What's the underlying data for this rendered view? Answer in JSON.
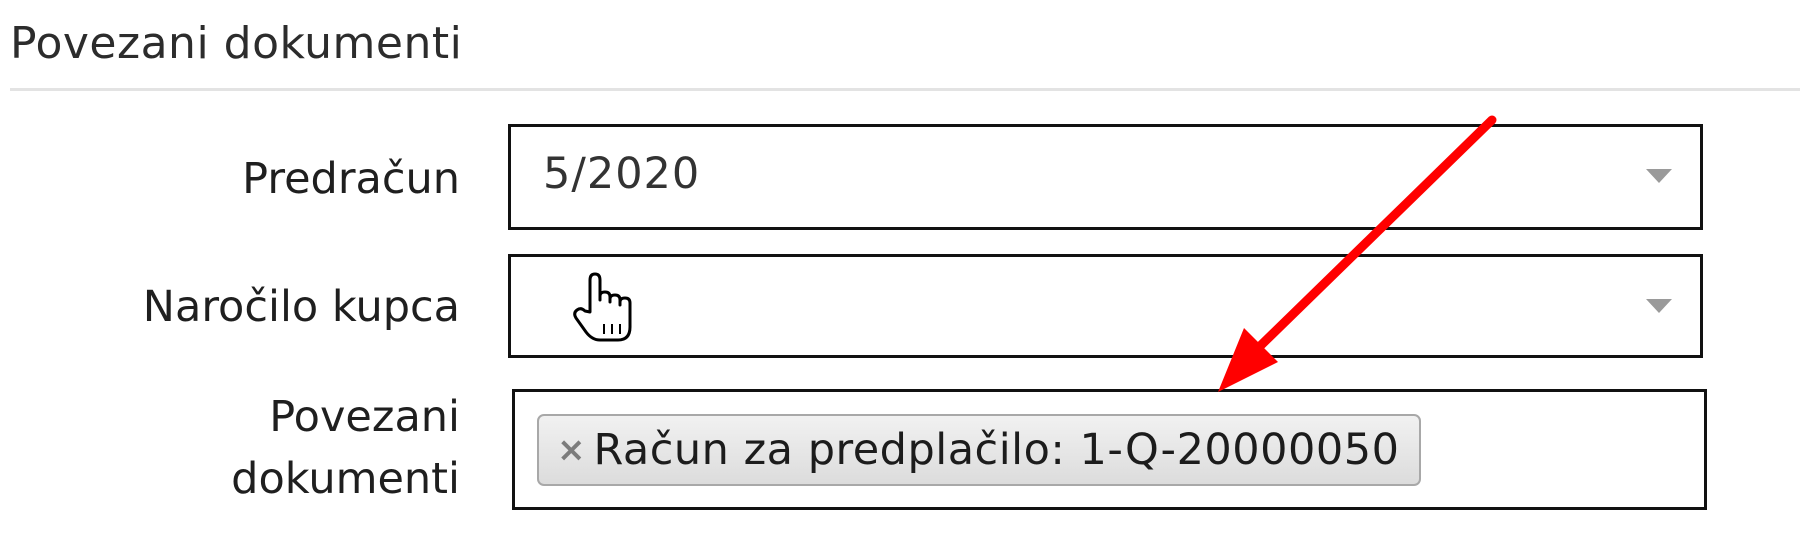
{
  "section": {
    "title": "Povezani dokumenti"
  },
  "fields": {
    "predracun": {
      "label": "Predračun",
      "value": "5/2020"
    },
    "narocilo": {
      "label": "Naročilo kupca",
      "value": ""
    },
    "povezani": {
      "label_line1": "Povezani",
      "label_line2": "dokumenti",
      "tag_remove": "×",
      "tag_label": "Račun za predplačilo: 1-Q-20000050"
    }
  },
  "icons": {
    "dropdown": "chevron-down-icon",
    "cursor": "hand-pointer-icon",
    "remove": "close-icon"
  },
  "colors": {
    "annotation_arrow": "#ff0000",
    "field_border": "#111111",
    "tag_background": "#e6e6e6"
  }
}
